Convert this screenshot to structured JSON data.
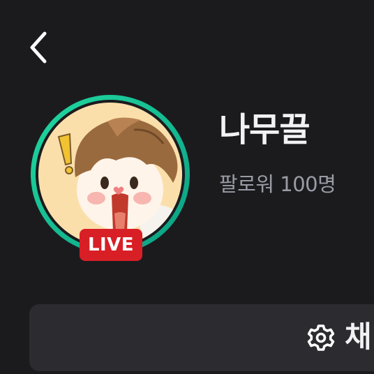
{
  "header": {
    "back_icon": "chevron-left-icon"
  },
  "profile": {
    "channel_name": "나무끌",
    "followers_text": "팔로워 100명",
    "live_badge": "LIVE",
    "ring_color_start": "#19d39a",
    "ring_color_end": "#0aa88a",
    "live_color": "#d81f26"
  },
  "actions": {
    "settings_icon": "gear-icon",
    "settings_label": "채"
  }
}
